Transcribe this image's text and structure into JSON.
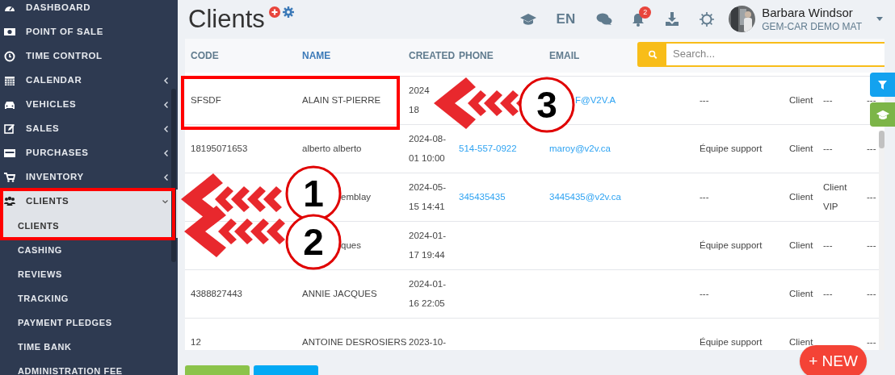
{
  "sidebar": {
    "items": [
      {
        "label": "DASHBOARD",
        "selected": false
      },
      {
        "label": "POINT OF SALE",
        "selected": false
      },
      {
        "label": "TIME CONTROL",
        "selected": false
      },
      {
        "label": "CALENDAR",
        "selected": false,
        "expanded": false
      },
      {
        "label": "VEHICLES",
        "selected": false,
        "expanded": false
      },
      {
        "label": "SALES",
        "selected": false,
        "expanded": false
      },
      {
        "label": "PURCHASES",
        "selected": false,
        "expanded": false
      },
      {
        "label": "INVENTORY",
        "selected": false,
        "expanded": false
      },
      {
        "label": "CLIENTS",
        "selected": true,
        "expanded": true,
        "children": [
          {
            "label": "CLIENTS",
            "selected": true
          },
          {
            "label": "CASHING",
            "selected": false
          },
          {
            "label": "REVIEWS",
            "selected": false
          },
          {
            "label": "TRACKING",
            "selected": false
          },
          {
            "label": "PAYMENT PLEDGES",
            "selected": false
          },
          {
            "label": "TIME BANK",
            "selected": false
          },
          {
            "label": "ADMINISTRATION FEE",
            "selected": false
          }
        ]
      }
    ]
  },
  "header": {
    "title": "Clients",
    "language": "EN",
    "notifications": "2",
    "user_name": "Barbara Windsor",
    "user_company": "GEM-CAR DEMO MAT"
  },
  "search": {
    "placeholder": "Search..."
  },
  "table": {
    "columns": [
      {
        "label": "CODE",
        "sorted": false
      },
      {
        "label": "NAME",
        "sorted": true
      },
      {
        "label": "CREATED",
        "sorted": false
      },
      {
        "label": "PHONE",
        "sorted": false
      },
      {
        "label": "EMAIL",
        "sorted": false
      }
    ],
    "rows": [
      {
        "code": "SFSDF",
        "name": "ALAIN ST-PIERRE",
        "created": [
          "2024",
          "18"
        ],
        "email": "F@V2V.A",
        "email_cut_left": true,
        "column_6": "---",
        "column_7": "Client",
        "column_8": [
          "---"
        ],
        "column_9": "---"
      },
      {
        "code": "18195071653",
        "name": "alberto alberto",
        "created": [
          "2024-08-",
          "01 10:00"
        ],
        "phone": "514-557-0922",
        "email": "maroy@v2v.ca",
        "column_6": "Équipe support",
        "column_7": "Client",
        "column_8": [
          "---"
        ],
        "column_9": "---"
      },
      {
        "name": "emblay",
        "name_cut_left": true,
        "created": [
          "2024-05-",
          "15 14:41"
        ],
        "phone": "345435435",
        "email": "3445435@v2v.ca",
        "column_6": "---",
        "column_7": "Client",
        "column_8": [
          "Client",
          "VIP"
        ],
        "column_9": "---"
      },
      {
        "name": "ques",
        "name_cut_left": true,
        "created": [
          "2024-01-",
          "17 19:44"
        ],
        "column_6": "Équipe support",
        "column_7": "Client",
        "column_8": [
          "---"
        ],
        "column_9": "---"
      },
      {
        "code": "4388827443",
        "name": "ANNIE JACQUES",
        "created": [
          "2024-01-",
          "16 22:05"
        ],
        "column_6": "---",
        "column_7": "Client",
        "column_8": [
          "---"
        ],
        "column_9": "---"
      },
      {
        "code": "12",
        "name": "ANTOINE DESROSIERS",
        "created": [
          "2023-10-"
        ],
        "column_6": "Équipe support",
        "column_7": "Client",
        "column_9": "---"
      }
    ]
  },
  "new_button": {
    "label": "+ NEW"
  },
  "annotations": [
    {
      "label": "1"
    },
    {
      "label": "2"
    },
    {
      "label": "3"
    }
  ]
}
